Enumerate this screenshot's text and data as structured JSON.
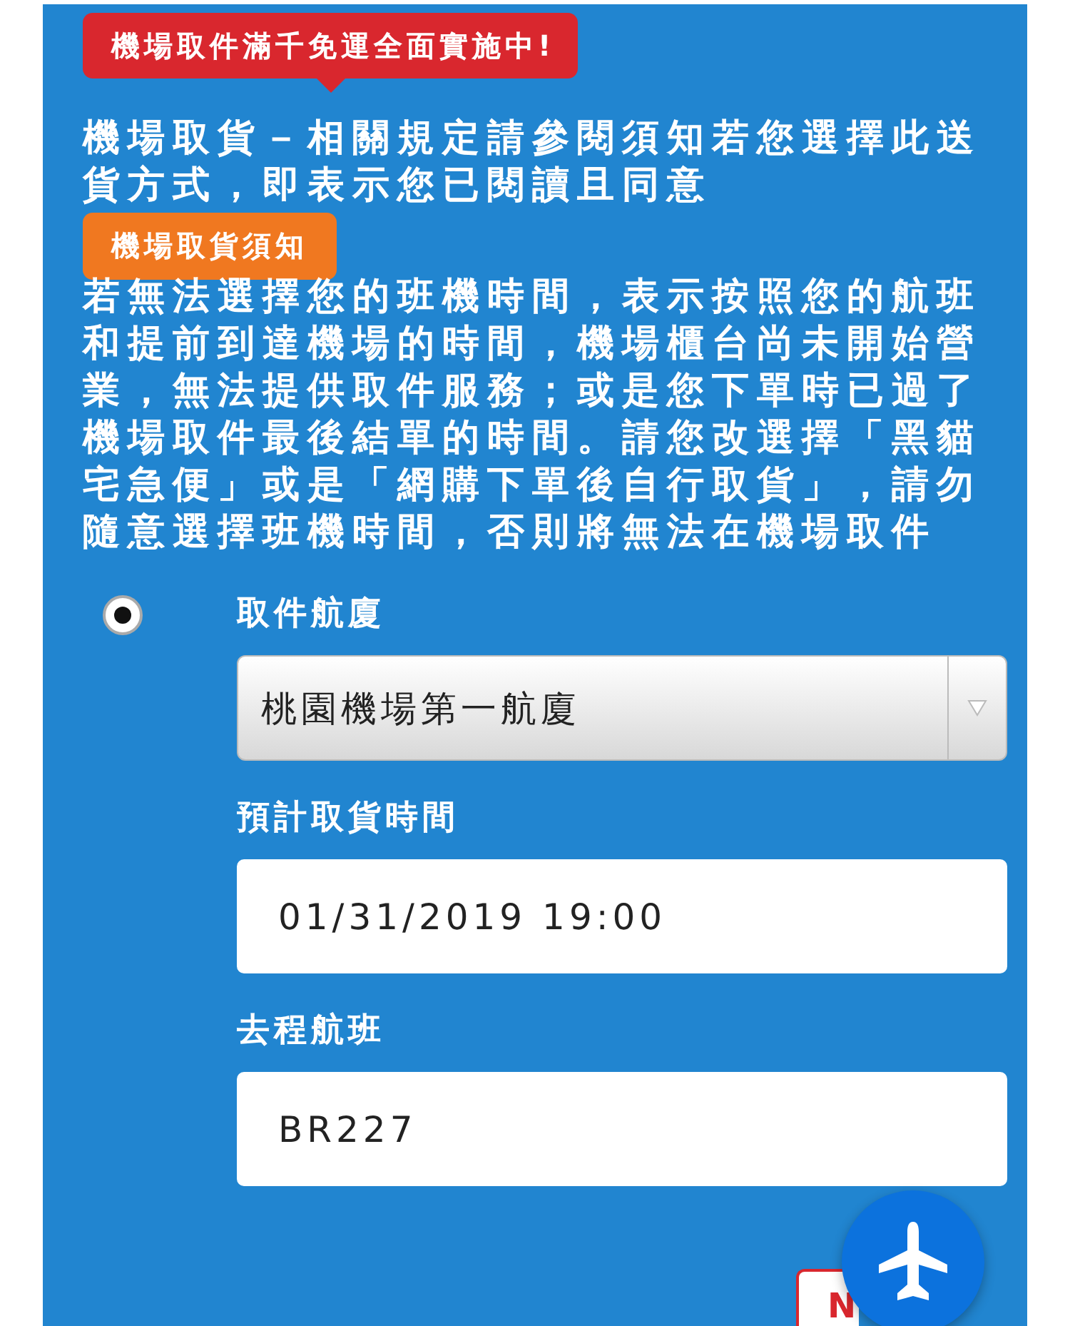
{
  "promo_tooltip": "機場取件滿千免運全面實施中!",
  "notice_text": "機場取貨－相關規定請參閱須知若您選擇此送貨方式，即表示您已閱讀且同意",
  "notice_button": "機場取貨須知",
  "warning_text": "若無法選擇您的班機時間，表示按照您的航班和提前到達機場的時間，機場櫃台尚未開始營業，無法提供取件服務；或是您下單時已過了機場取件最後結單的時間。請您改選擇「黑貓宅急便」或是「網購下單後自行取貨」，請勿隨意選擇班機時間，否則將無法在機場取件",
  "option": {
    "selected": true
  },
  "fields": [
    {
      "kind": "select",
      "label": "取件航廈",
      "value": "桃園機場第一航廈"
    },
    {
      "kind": "input",
      "label": "預計取貨時間",
      "value": "01/31/2019 19:00"
    },
    {
      "kind": "input",
      "label": "去程航班",
      "value": "BR227"
    }
  ],
  "next_button": "N"
}
